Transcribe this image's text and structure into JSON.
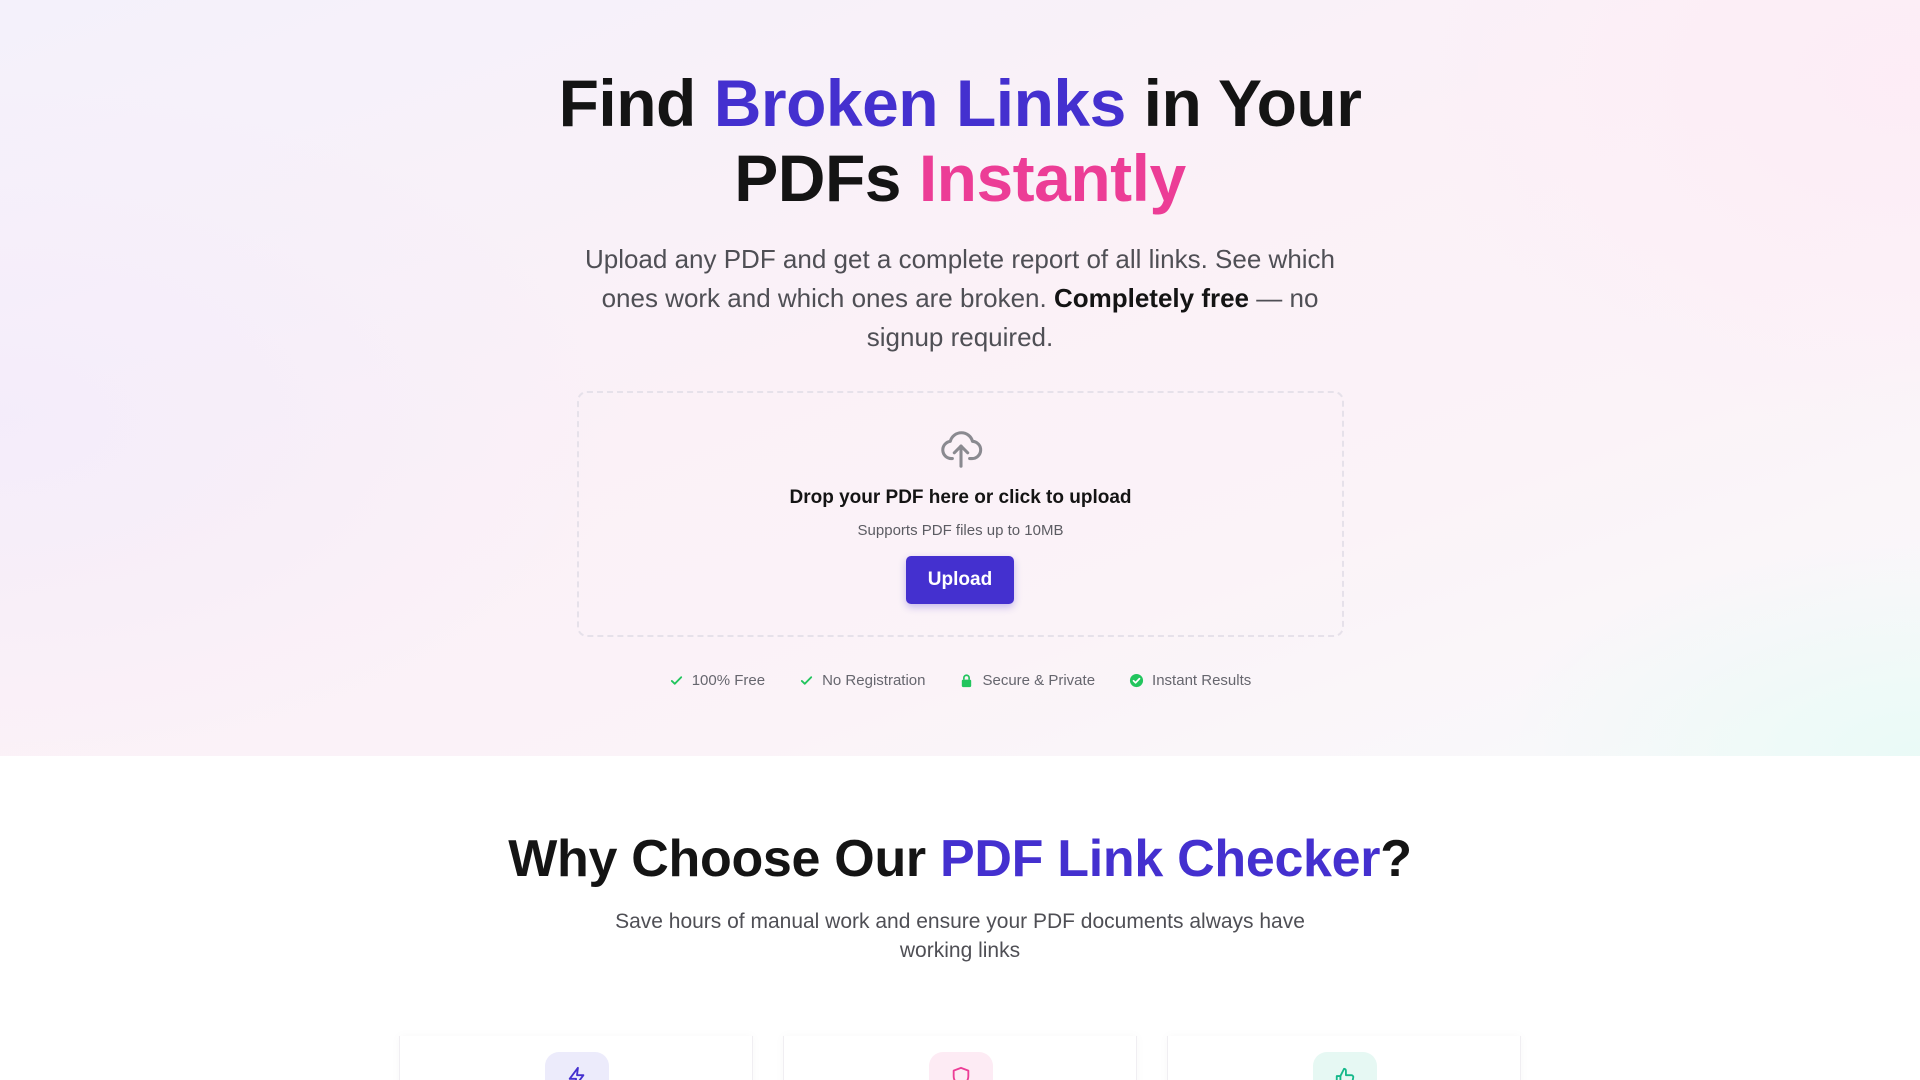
{
  "hero": {
    "title_line1_part1": "Find",
    "title_line1_highlight": "Broken Links",
    "title_line1_part2": "in Your",
    "title_line2_part1": "PDFs",
    "title_line2_highlight": "Instantly",
    "subtitle_part1": "Upload any PDF and get a complete report of all links. See which ones work and which ones are broken.",
    "subtitle_bold": "Completely free",
    "subtitle_part2": "— no signup required."
  },
  "dropzone": {
    "icon": "cloud-upload-icon",
    "title": "Drop your PDF here or click to upload",
    "subtitle": "Supports PDF files up to 10MB",
    "button_label": "Upload"
  },
  "badges": [
    {
      "icon": "check-icon",
      "label": "100% Free"
    },
    {
      "icon": "check-icon",
      "label": "No Registration"
    },
    {
      "icon": "lock-icon",
      "label": "Secure & Private"
    },
    {
      "icon": "check-circle-icon",
      "label": "Instant Results"
    }
  ],
  "features": {
    "title_part1": "Why Choose Our",
    "title_highlight": "PDF Link Checker",
    "title_part2": "?",
    "subtitle": "Save hours of manual work and ensure your PDF documents always have working links",
    "cards": [
      {
        "icon": "lightning-icon"
      },
      {
        "icon": "shield-icon"
      },
      {
        "icon": "thumbs-up-icon"
      }
    ]
  },
  "colors": {
    "brand": "#4430cf",
    "accent_pink": "#ec3d96",
    "success": "#22c55e"
  }
}
